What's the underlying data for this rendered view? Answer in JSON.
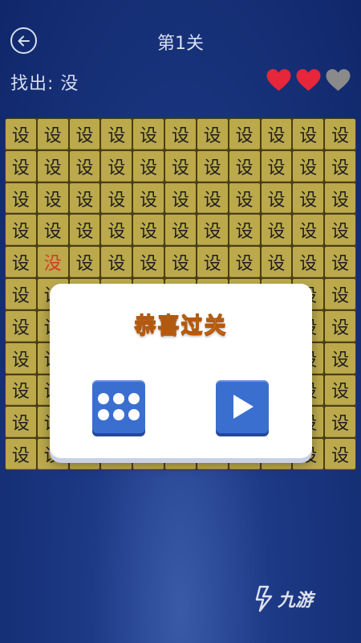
{
  "header": {
    "level_title": "第1关",
    "find_prefix": "找出: ",
    "target_char": "没"
  },
  "lives": {
    "total": 3,
    "remaining": 2,
    "colors": {
      "full": "#e5263b",
      "empty": "#8a8a8a"
    },
    "icon": "heart-icon"
  },
  "grid": {
    "rows": 11,
    "cols": 11,
    "fill_char": "设",
    "target_row": 4,
    "target_col": 1,
    "target_color": "#d33a2a",
    "cell_color": "#bba94c"
  },
  "dialog": {
    "title": "恭喜过关",
    "menu_icon": "grid-dots-icon",
    "next_icon": "play-icon"
  },
  "watermark": {
    "text": "九游"
  }
}
